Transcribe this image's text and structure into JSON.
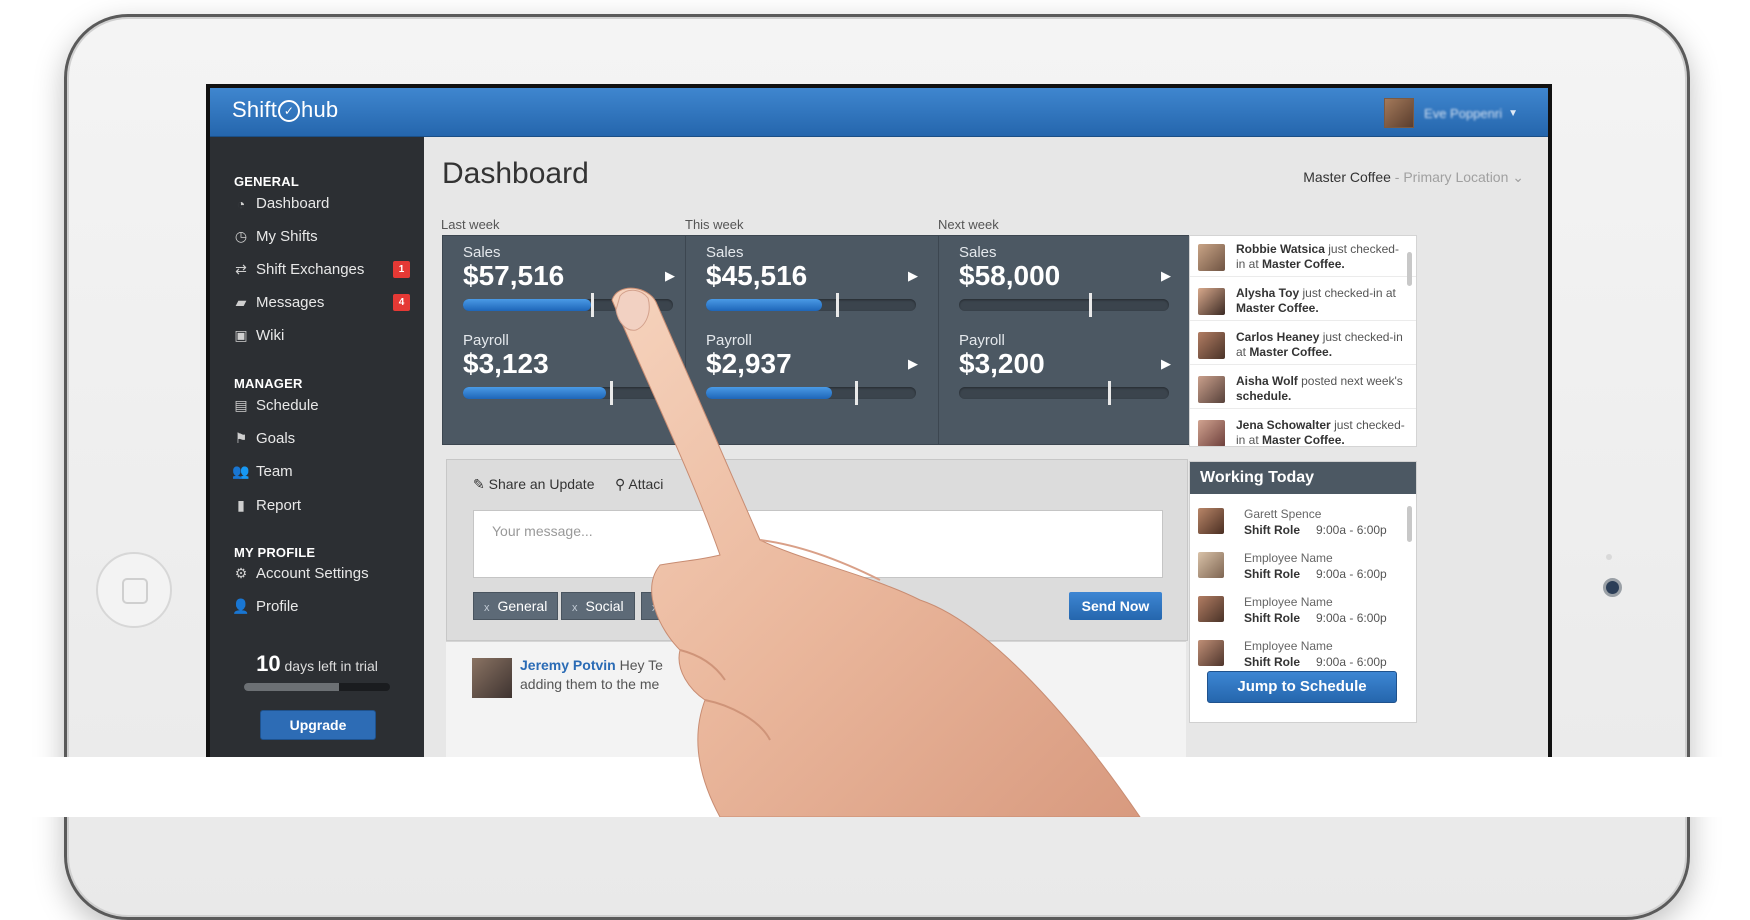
{
  "app": {
    "logo_left": "Shift",
    "logo_right": "hub",
    "user_name": "Eve Poppenri"
  },
  "sidebar": {
    "sections": [
      {
        "title": "GENERAL"
      },
      {
        "title": "MANAGER"
      },
      {
        "title": "MY PROFILE"
      }
    ],
    "items": [
      {
        "label": "Dashboard",
        "icon": "dashboard-gauge-icon"
      },
      {
        "label": "My Shifts",
        "icon": "clock-icon"
      },
      {
        "label": "Shift Exchanges",
        "icon": "exchange-icon",
        "badge": "1"
      },
      {
        "label": "Messages",
        "icon": "chat-bubble-icon",
        "badge": "4"
      },
      {
        "label": "Wiki",
        "icon": "briefcase-icon"
      },
      {
        "label": "Schedule",
        "icon": "calendar-icon"
      },
      {
        "label": "Goals",
        "icon": "flag-icon"
      },
      {
        "label": "Team",
        "icon": "team-icon"
      },
      {
        "label": "Report",
        "icon": "clipboard-icon"
      },
      {
        "label": "Account Settings",
        "icon": "gear-icon"
      },
      {
        "label": "Profile",
        "icon": "user-icon"
      }
    ],
    "trial": {
      "days": "10",
      "text": "days left in trial",
      "progress": 0.65
    },
    "upgrade_label": "Upgrade"
  },
  "main": {
    "title": "Dashboard",
    "location": {
      "name": "Master Coffee",
      "sub": "- Primary Location"
    },
    "weeks": [
      {
        "label": "Last week",
        "sales_label": "Sales",
        "sales": "$57,516",
        "sales_fill": 0.61,
        "sales_marker": 0.61,
        "payroll_label": "Payroll",
        "payroll": "$3,123",
        "payroll_fill": 0.68,
        "payroll_marker": 0.7
      },
      {
        "label": "This week",
        "sales_label": "Sales",
        "sales": "$45,516",
        "sales_fill": 0.55,
        "sales_marker": 0.62,
        "payroll_label": "Payroll",
        "payroll": "$2,937",
        "payroll_fill": 0.6,
        "payroll_marker": 0.71
      },
      {
        "label": "Next week",
        "sales_label": "Sales",
        "sales": "$58,000",
        "sales_fill": 0.0,
        "sales_marker": 0.62,
        "payroll_label": "Payroll",
        "payroll": "$3,200",
        "payroll_fill": 0.0,
        "payroll_marker": 0.71
      }
    ],
    "feed": [
      {
        "name": "Robbie Watsica",
        "text": "just checked-in at",
        "place": "Master Coffee."
      },
      {
        "name": "Alysha Toy",
        "text": "just checked-in at",
        "place": "Master Coffee."
      },
      {
        "name": "Carlos Heaney",
        "text": "just checked-in at",
        "place": "Master Coffee."
      },
      {
        "name": "Aisha Wolf",
        "text": "posted next week's",
        "place": "schedule."
      },
      {
        "name": "Jena Schowalter",
        "text": "just checked-in at",
        "place": "Master Coffee."
      }
    ],
    "update": {
      "share_label": "Share an Update",
      "attach_label": "Attaci",
      "placeholder": "Your message...",
      "tags": [
        "General",
        "Social",
        ""
      ],
      "send_label": "Send Now"
    },
    "post": {
      "name": "Jeremy Potvin",
      "text": "Hey Te",
      "line2": "adding them to the me"
    },
    "working_today": {
      "title": "Working Today",
      "rows": [
        {
          "name": "Garett Spence",
          "role": "Shift Role",
          "hours": "9:00a - 6:00p"
        },
        {
          "name": "Employee Name",
          "role": "Shift Role",
          "hours": "9:00a - 6:00p"
        },
        {
          "name": "Employee Name",
          "role": "Shift Role",
          "hours": "9:00a - 6:00p"
        },
        {
          "name": "Employee Name",
          "role": "Shift Role",
          "hours": "9:00a - 6:00p"
        }
      ],
      "button_label": "Jump to Schedule"
    }
  },
  "colors": {
    "topbar": "#2d72bd",
    "sidebar": "#2c2f33",
    "card": "#4c5863",
    "accent": "#2566ad",
    "badge": "#e53935"
  }
}
